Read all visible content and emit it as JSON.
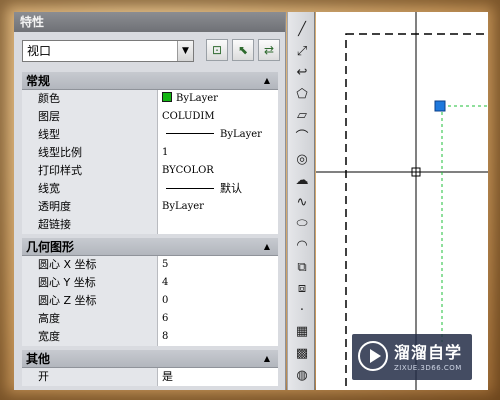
{
  "palette": {
    "title": "特性",
    "selector": {
      "value": "视口"
    },
    "toolbar_icons": [
      "quick-select-icon",
      "select-objects-icon",
      "toggle-pickadd-icon"
    ]
  },
  "sections": {
    "general": {
      "title": "常规",
      "rows": [
        {
          "label": "颜色",
          "value": "ByLayer",
          "swatch": "#13b513"
        },
        {
          "label": "图层",
          "value": "COLUDIM"
        },
        {
          "label": "线型",
          "value": "ByLayer",
          "line": true
        },
        {
          "label": "线型比例",
          "value": "1"
        },
        {
          "label": "打印样式",
          "value": "BYCOLOR"
        },
        {
          "label": "线宽",
          "value": "默认",
          "line": true
        },
        {
          "label": "透明度",
          "value": "ByLayer"
        },
        {
          "label": "超链接",
          "value": ""
        }
      ]
    },
    "geometry": {
      "title": "几何图形",
      "rows": [
        {
          "label": "圆心 X 坐标",
          "value": "5"
        },
        {
          "label": "圆心 Y 坐标",
          "value": "4"
        },
        {
          "label": "圆心 Z 坐标",
          "value": "0"
        },
        {
          "label": "高度",
          "value": "6"
        },
        {
          "label": "宽度",
          "value": "8"
        }
      ]
    },
    "misc": {
      "title": "其他",
      "rows": [
        {
          "label": "开",
          "value": "是"
        }
      ]
    }
  },
  "drawbar": {
    "tools": [
      {
        "name": "line-icon",
        "glyph": "╱"
      },
      {
        "name": "construction-line-icon",
        "glyph": "⤢"
      },
      {
        "name": "polyline-icon",
        "glyph": "↩"
      },
      {
        "name": "polygon-icon",
        "glyph": "⬠"
      },
      {
        "name": "rectangle-icon",
        "glyph": "▱"
      },
      {
        "name": "arc-icon",
        "glyph": "⌒"
      },
      {
        "name": "circle-icon",
        "glyph": "◎"
      },
      {
        "name": "revision-cloud-icon",
        "glyph": "☁"
      },
      {
        "name": "spline-icon",
        "glyph": "∿"
      },
      {
        "name": "ellipse-icon",
        "glyph": "⬭"
      },
      {
        "name": "ellipse-arc-icon",
        "glyph": "◠"
      },
      {
        "name": "insert-block-icon",
        "glyph": "⧉"
      },
      {
        "name": "make-block-icon",
        "glyph": "⧈"
      },
      {
        "name": "point-icon",
        "glyph": "·"
      },
      {
        "name": "hatch-icon",
        "glyph": "▦"
      },
      {
        "name": "gradient-icon",
        "glyph": "▩"
      },
      {
        "name": "region-icon",
        "glyph": "◍"
      }
    ]
  },
  "watermark": {
    "title": "溜溜自学",
    "subtitle": "ZIXUE.3D66.COM"
  },
  "colors": {
    "grip": "#1e78dc",
    "selection_dash": "#1fbf3a"
  }
}
